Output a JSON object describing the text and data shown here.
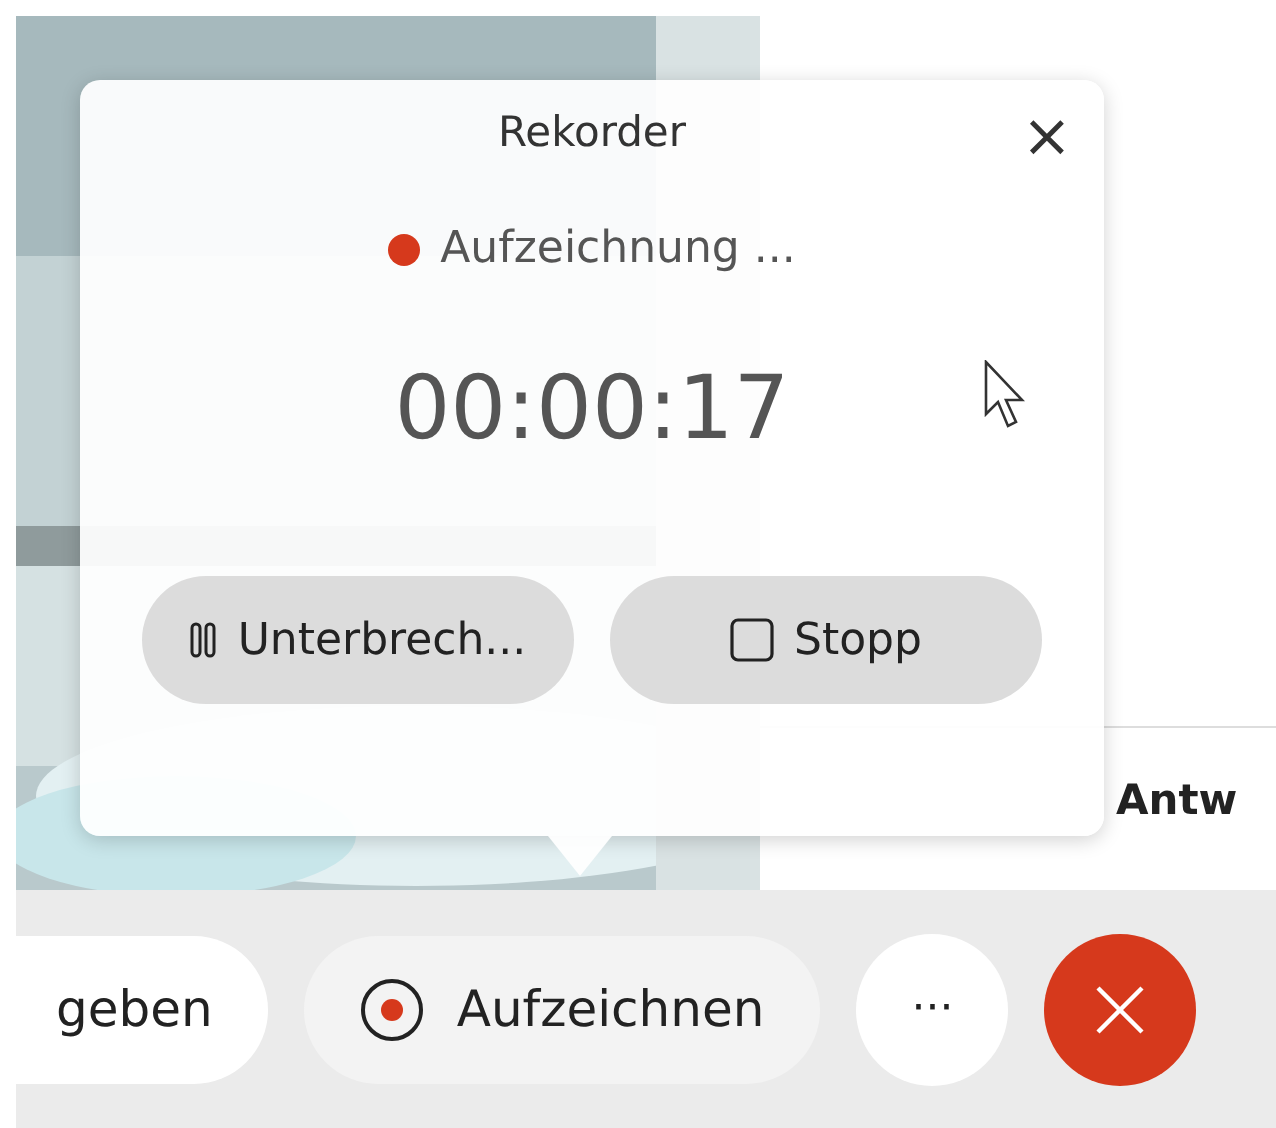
{
  "side_panel": {
    "item": "Antw"
  },
  "recorder": {
    "title": "Rekorder",
    "close": "×",
    "status": "Aufzeichnung ...",
    "recording": true,
    "timer": "00:00:17",
    "buttons": [
      {
        "kind": "pause",
        "label": "Unterbrech..."
      },
      {
        "kind": "stop",
        "label": "Stopp"
      }
    ]
  },
  "toolbar": [
    {
      "kind": "pill",
      "label": "geben",
      "active": false
    },
    {
      "kind": "record",
      "label": "Aufzeichnen",
      "active": true
    },
    {
      "kind": "more",
      "label": "···"
    },
    {
      "kind": "leave"
    }
  ]
}
